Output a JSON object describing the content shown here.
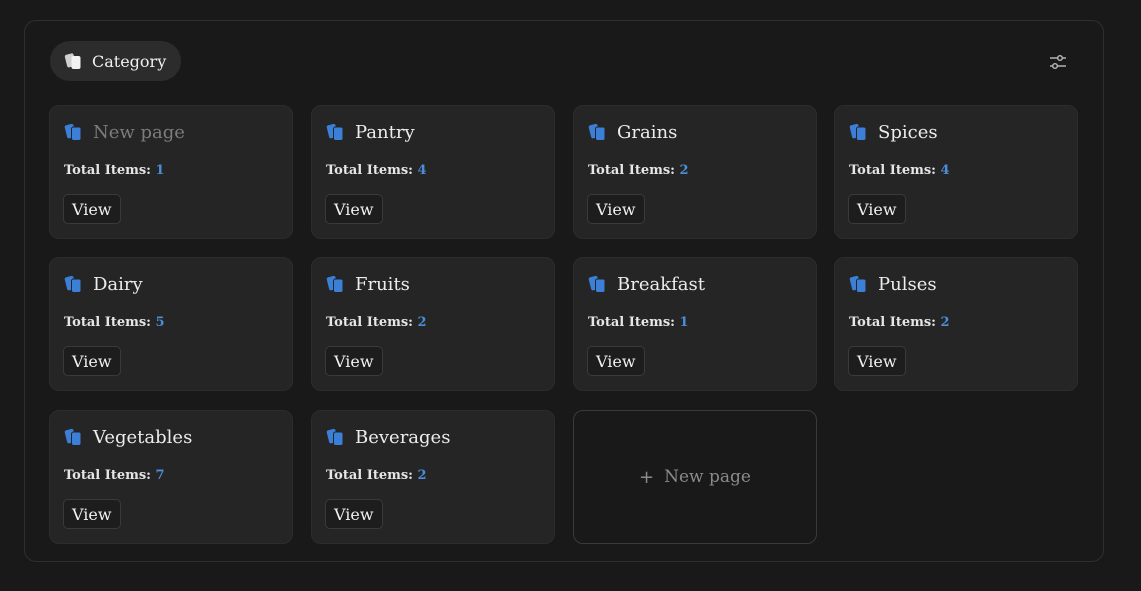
{
  "header": {
    "label": "Category",
    "icon": "cards-icon"
  },
  "settings": {
    "icon": "sliders-icon"
  },
  "colors": {
    "accent": "#3b7fd6",
    "count": "#4a8ed8"
  },
  "labels": {
    "total_items": "Total Items:",
    "view": "View"
  },
  "cards": [
    {
      "title": "New page",
      "count": "1",
      "muted": true
    },
    {
      "title": "Pantry",
      "count": "4"
    },
    {
      "title": "Grains",
      "count": "2"
    },
    {
      "title": "Spices",
      "count": "4"
    },
    {
      "title": "Dairy",
      "count": "5"
    },
    {
      "title": "Fruits",
      "count": "2"
    },
    {
      "title": "Breakfast",
      "count": "1"
    },
    {
      "title": "Pulses",
      "count": "2"
    },
    {
      "title": "Vegetables",
      "count": "7"
    },
    {
      "title": "Beverages",
      "count": "2"
    }
  ],
  "new_page": {
    "label": "New page",
    "icon": "plus-icon"
  }
}
